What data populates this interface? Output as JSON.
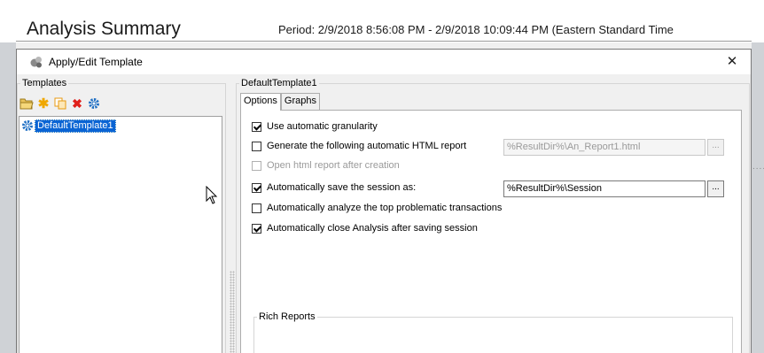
{
  "background": {
    "title": "Analysis Summary",
    "period": "Period: 2/9/2018 8:56:08 PM - 2/9/2018 10:09:44 PM (Eastern Standard Time"
  },
  "dialog": {
    "title": "Apply/Edit Template",
    "close_label": "✕",
    "templates_group": {
      "legend": "Templates",
      "toolbar": [
        {
          "icon": "open-folder-icon",
          "glyph": "📂"
        },
        {
          "icon": "new-star-icon",
          "glyph": "✱"
        },
        {
          "icon": "copy-icon",
          "glyph": "⧉"
        },
        {
          "icon": "delete-icon",
          "glyph": "✖"
        },
        {
          "icon": "gear-icon",
          "glyph": "⚙"
        }
      ],
      "items": [
        {
          "label": "DefaultTemplate1",
          "selected": true
        }
      ]
    },
    "template_group": {
      "legend": "DefaultTemplate1",
      "tabs": [
        {
          "label": "Options",
          "active": true
        },
        {
          "label": "Graphs",
          "active": false
        }
      ],
      "options": {
        "granularity": {
          "label": "Use automatic granularity",
          "checked": true
        },
        "html_report": {
          "label": "Generate the following automatic HTML report",
          "checked": false,
          "value": "%ResultDir%\\An_Report1.html"
        },
        "open_html": {
          "label": "Open html report after creation",
          "checked": false
        },
        "save_session": {
          "label": "Automatically save the session as:",
          "checked": true,
          "value": "%ResultDir%\\Session"
        },
        "analyze_top": {
          "label": "Automatically analyze the top problematic transactions",
          "checked": false
        },
        "close_analysis": {
          "label": "Automatically close Analysis after saving session",
          "checked": true
        }
      },
      "browse_label": "...",
      "rich_reports": {
        "legend": "Rich Reports"
      }
    }
  },
  "colors": {
    "selection": "#0a64d4",
    "dialog_bg": "#f0f0f0",
    "delete_red": "#e0201b",
    "star_yellow": "#f0a800",
    "copy_orange": "#e89a10",
    "gear_blue": "#1f6fc4"
  }
}
